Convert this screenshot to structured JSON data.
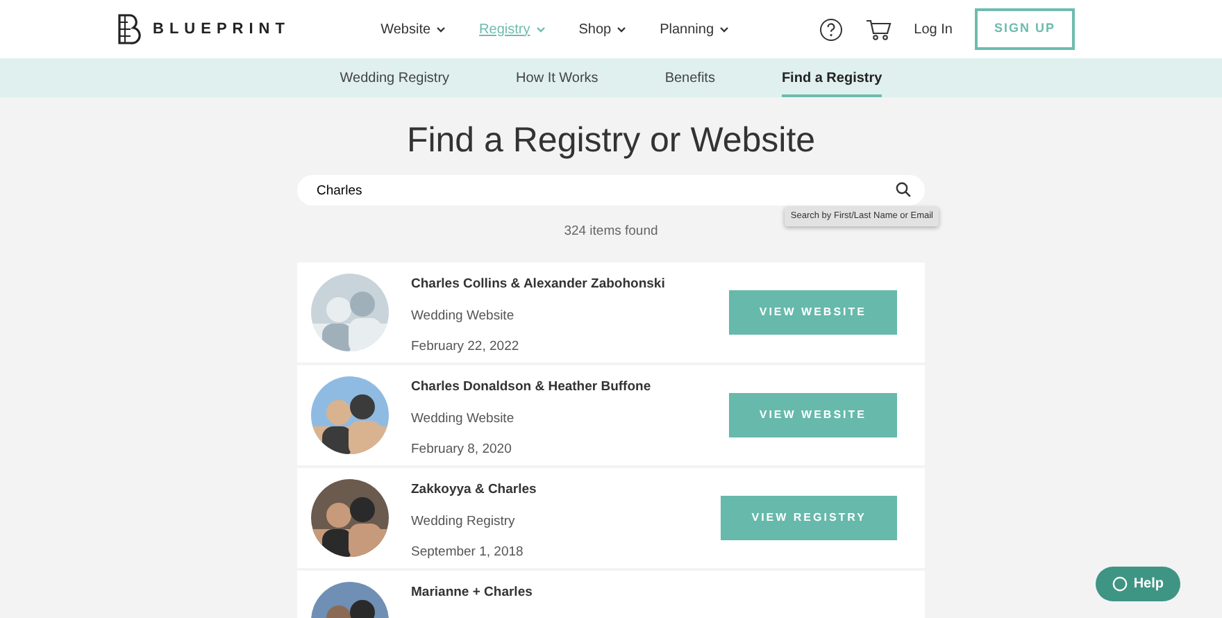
{
  "brand": {
    "name": "BLUEPRINT"
  },
  "main_nav": [
    {
      "label": "Website",
      "selected": false
    },
    {
      "label": "Registry",
      "selected": true
    },
    {
      "label": "Shop",
      "selected": false
    },
    {
      "label": "Planning",
      "selected": false
    }
  ],
  "header_actions": {
    "login": "Log In",
    "signup": "SIGN UP"
  },
  "sub_nav": [
    {
      "label": "Wedding Registry",
      "selected": false
    },
    {
      "label": "How It Works",
      "selected": false
    },
    {
      "label": "Benefits",
      "selected": false
    },
    {
      "label": "Find a Registry",
      "selected": true
    }
  ],
  "title": "Find a Registry or Website",
  "search": {
    "value": "Charles",
    "tooltip": "Search by First/Last Name or Email"
  },
  "result_count": "324 items found",
  "results": [
    {
      "names": "Charles Collins & Alexander Zabohonski",
      "type": "Wedding Website",
      "date": "February 22, 2022",
      "button": "VIEW WEBSITE"
    },
    {
      "names": "Charles Donaldson & Heather Buffone",
      "type": "Wedding Website",
      "date": "February 8, 2020",
      "button": "VIEW WEBSITE"
    },
    {
      "names": "Zakkoyya & Charles",
      "type": "Wedding Registry",
      "date": "September 1, 2018",
      "button": "VIEW REGISTRY"
    },
    {
      "names": "Marianne + Charles"
    }
  ],
  "help": {
    "label": "Help"
  }
}
